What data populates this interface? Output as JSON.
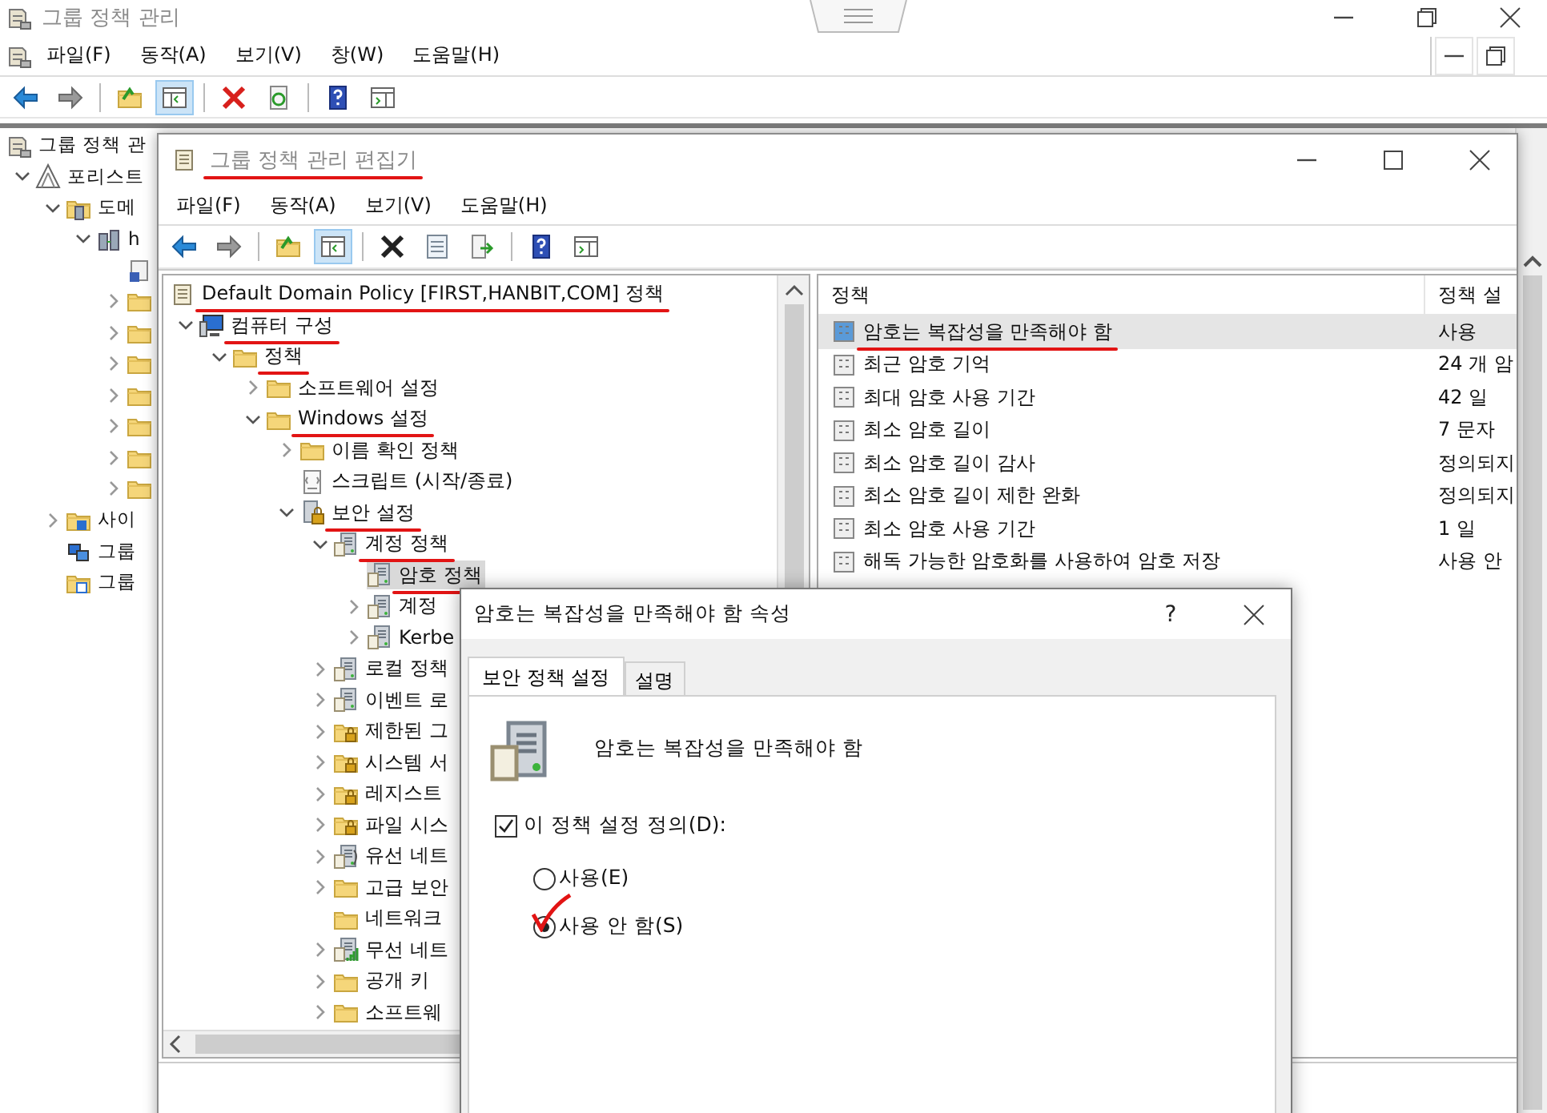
{
  "outer_window": {
    "title": "그룹 정책 관리",
    "menu": [
      "파일(F)",
      "동작(A)",
      "보기(V)",
      "창(W)",
      "도움말(H)"
    ],
    "toolbar": [
      {
        "kind": "back",
        "pressed": false
      },
      {
        "kind": "forward",
        "pressed": false
      },
      {
        "kind": "separator"
      },
      {
        "kind": "up",
        "pressed": false
      },
      {
        "kind": "tree",
        "pressed": true
      },
      {
        "kind": "separator"
      },
      {
        "kind": "delete-red",
        "pressed": false
      },
      {
        "kind": "refresh",
        "pressed": false
      },
      {
        "kind": "separator"
      },
      {
        "kind": "help",
        "pressed": false
      },
      {
        "kind": "panel",
        "pressed": false
      }
    ],
    "tree": [
      {
        "label": "그룹 정책 관",
        "kind": "gpm",
        "selected": false,
        "children": [
          {
            "label": "포리스트",
            "kind": "forest",
            "expanded": true,
            "selected": false,
            "children": [
              {
                "label": "도메",
                "kind": "domains",
                "expanded": true,
                "selected": false,
                "children": [
                  {
                    "label": "h",
                    "kind": "domain",
                    "expanded": true,
                    "selected": false,
                    "children": [
                      {
                        "kind": "gpo",
                        "selected": false
                      },
                      {
                        "kind": "folder",
                        "expanded": false,
                        "selected": false
                      },
                      {
                        "kind": "folder",
                        "expanded": false,
                        "selected": false
                      },
                      {
                        "kind": "folder",
                        "expanded": false,
                        "selected": false
                      },
                      {
                        "kind": "folder",
                        "expanded": false,
                        "selected": false
                      },
                      {
                        "kind": "folder",
                        "expanded": false,
                        "selected": false
                      },
                      {
                        "kind": "folder",
                        "expanded": false,
                        "selected": false
                      },
                      {
                        "kind": "folder",
                        "expanded": false,
                        "selected": false
                      }
                    ]
                  }
                ]
              },
              {
                "label": "사이",
                "kind": "site",
                "expanded": false,
                "selected": false
              },
              {
                "label": "그룹",
                "kind": "modeling",
                "selected": false
              },
              {
                "label": "그룹",
                "kind": "results",
                "selected": false
              }
            ]
          }
        ]
      }
    ]
  },
  "editor_window": {
    "title": "그룹 정책 관리 편집기",
    "title_underlined": true,
    "menu": [
      "파일(F)",
      "동작(A)",
      "보기(V)",
      "도움말(H)"
    ],
    "toolbar": [
      {
        "kind": "back",
        "pressed": false
      },
      {
        "kind": "forward",
        "pressed": false
      },
      {
        "kind": "separator"
      },
      {
        "kind": "up",
        "pressed": false
      },
      {
        "kind": "tree",
        "pressed": true
      },
      {
        "kind": "separator"
      },
      {
        "kind": "delete",
        "pressed": false
      },
      {
        "kind": "properties",
        "pressed": false
      },
      {
        "kind": "export",
        "pressed": false
      },
      {
        "kind": "separator"
      },
      {
        "kind": "help",
        "pressed": false
      },
      {
        "kind": "panel",
        "pressed": false
      }
    ],
    "tree": [
      {
        "label": "Default Domain Policy [FIRST,HANBIT,COM] 정책",
        "kind": "doc",
        "selected": false,
        "underlined": true,
        "children": [
          {
            "label": "컴퓨터 구성",
            "kind": "computer",
            "expanded": true,
            "selected": false,
            "underlined": true,
            "children": [
              {
                "label": "정책",
                "kind": "folder",
                "expanded": true,
                "selected": false,
                "underlined": true,
                "children": [
                  {
                    "label": "소프트웨어 설정",
                    "kind": "folder",
                    "expanded": false,
                    "selected": false,
                    "underlined": false
                  },
                  {
                    "label": "Windows 설정",
                    "kind": "folder",
                    "expanded": true,
                    "selected": false,
                    "underlined": true,
                    "children": [
                      {
                        "label": "이름 확인 정책",
                        "kind": "folder",
                        "expanded": false,
                        "selected": false,
                        "underlined": false
                      },
                      {
                        "label": "스크립트 (시작/종료)",
                        "kind": "script",
                        "selected": false,
                        "underlined": false
                      },
                      {
                        "label": "보안 설정",
                        "kind": "security",
                        "expanded": true,
                        "selected": false,
                        "underlined": true,
                        "children": [
                          {
                            "label": "계정 정책",
                            "kind": "server",
                            "expanded": true,
                            "selected": false,
                            "underlined": true,
                            "children": [
                              {
                                "label": "암호 정책",
                                "kind": "server",
                                "selected": true,
                                "underlined": true
                              },
                              {
                                "label": "계정",
                                "kind": "server",
                                "expanded": false,
                                "selected": false,
                                "underlined": false
                              },
                              {
                                "label": "Kerbe",
                                "kind": "server",
                                "expanded": false,
                                "selected": false,
                                "underlined": false
                              }
                            ]
                          },
                          {
                            "label": "로컬 정책",
                            "kind": "server",
                            "expanded": false,
                            "selected": false,
                            "underlined": false
                          },
                          {
                            "label": "이벤트 로",
                            "kind": "server",
                            "expanded": false,
                            "selected": false,
                            "underlined": false
                          },
                          {
                            "label": "제한된 그",
                            "kind": "lockfolder",
                            "expanded": false,
                            "selected": false,
                            "underlined": false
                          },
                          {
                            "label": "시스템 서",
                            "kind": "lockfolder",
                            "expanded": false,
                            "selected": false,
                            "underlined": false
                          },
                          {
                            "label": "레지스트",
                            "kind": "lockfolder",
                            "expanded": false,
                            "selected": false,
                            "underlined": false
                          },
                          {
                            "label": "파일 시스",
                            "kind": "lockfolder",
                            "expanded": false,
                            "selected": false,
                            "underlined": false
                          },
                          {
                            "label": "유선 네트",
                            "kind": "wired",
                            "expanded": false,
                            "selected": false,
                            "underlined": false
                          },
                          {
                            "label": "고급 보안",
                            "kind": "folder",
                            "expanded": false,
                            "selected": false,
                            "underlined": false
                          },
                          {
                            "label": "네트워크",
                            "kind": "folder",
                            "selected": false,
                            "underlined": false
                          },
                          {
                            "label": "무선 네트",
                            "kind": "wireless",
                            "expanded": false,
                            "selected": false,
                            "underlined": false
                          },
                          {
                            "label": "공개 키",
                            "kind": "folder",
                            "expanded": false,
                            "selected": false,
                            "underlined": false
                          },
                          {
                            "label": "소프트웨",
                            "kind": "folder",
                            "expanded": false,
                            "selected": false,
                            "underlined": false
                          }
                        ]
                      }
                    ]
                  }
                ]
              }
            ]
          }
        ]
      }
    ],
    "list": {
      "columns": [
        "정책",
        "정책 설"
      ],
      "rows": [
        {
          "policy": "암호는 복잡성을 만족해야 함",
          "setting": "사용",
          "selected": true,
          "underlined": true
        },
        {
          "policy": "최근 암호 기억",
          "setting": "24 개 암",
          "selected": false,
          "underlined": false
        },
        {
          "policy": "최대 암호 사용 기간",
          "setting": "42 일",
          "selected": false,
          "underlined": false
        },
        {
          "policy": "최소 암호 길이",
          "setting": "7 문자",
          "selected": false,
          "underlined": false
        },
        {
          "policy": "최소 암호 길이 감사",
          "setting": "정의되지",
          "selected": false,
          "underlined": false
        },
        {
          "policy": "최소 암호 길이 제한 완화",
          "setting": "정의되지",
          "selected": false,
          "underlined": false
        },
        {
          "policy": "최소 암호 사용 기간",
          "setting": "1 일",
          "selected": false,
          "underlined": false
        },
        {
          "policy": "해독 가능한 암호화를 사용하여 암호 저장",
          "setting": "사용 안",
          "selected": false,
          "underlined": false
        }
      ]
    }
  },
  "dialog": {
    "title": "암호는 복잡성을 만족해야 함 속성",
    "help_button": "?",
    "tabs": [
      {
        "label": "보안 정책 설정",
        "selected": true
      },
      {
        "label": "설명",
        "selected": false
      }
    ],
    "policy_name": "암호는 복잡성을 만족해야 함",
    "define_checkbox": {
      "label": "이 정책 설정 정의(D):",
      "checked": true
    },
    "options": [
      {
        "label": "사용(E)",
        "selected": false,
        "annotated": false
      },
      {
        "label": "사용 안 함(S)",
        "selected": true,
        "annotated": true
      }
    ]
  }
}
